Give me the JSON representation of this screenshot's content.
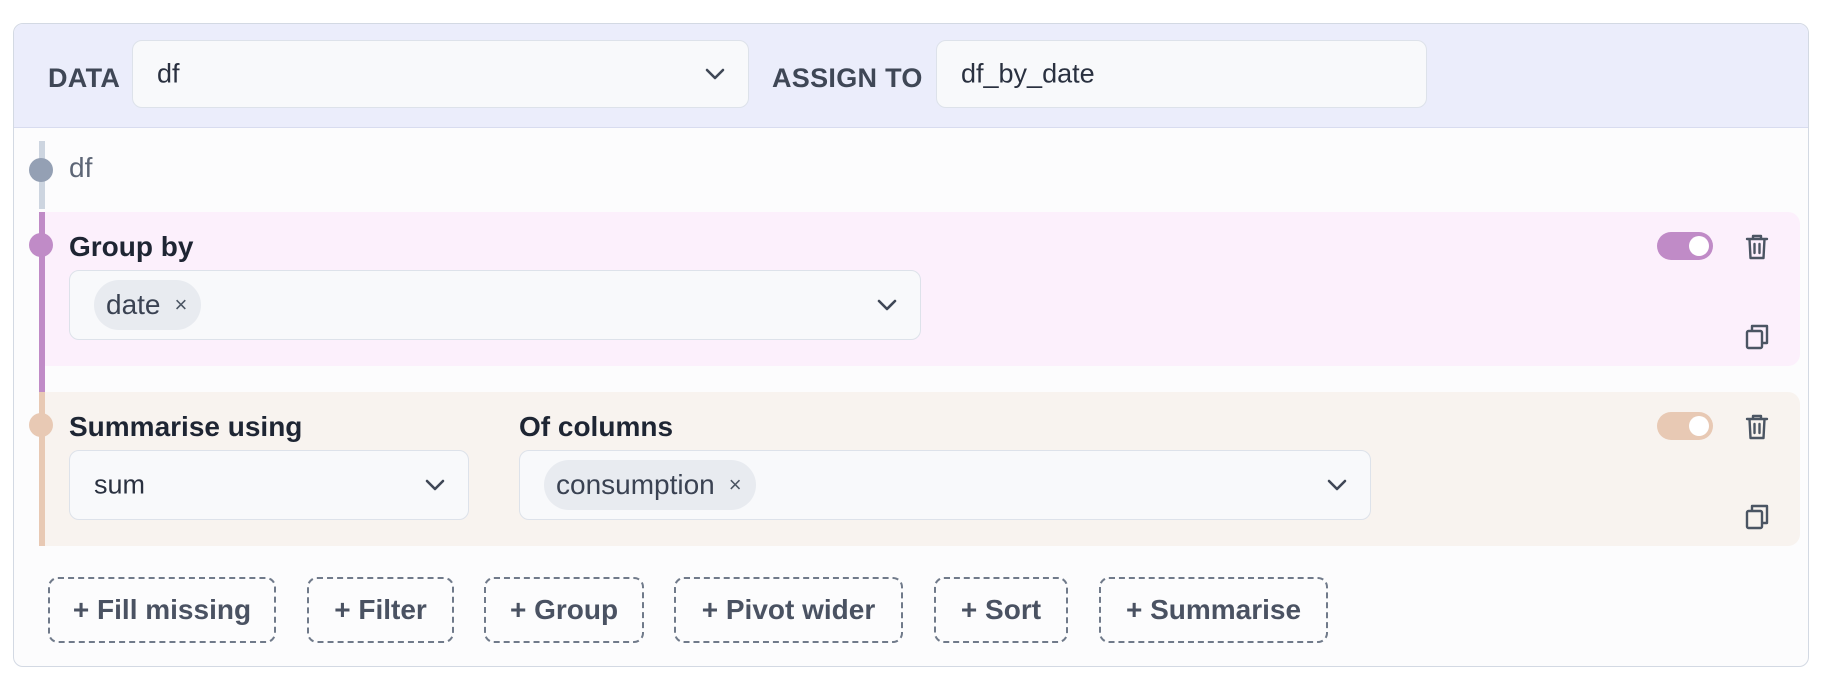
{
  "header": {
    "data_label": "DATA",
    "data_value": "df",
    "assign_label": "ASSIGN TO",
    "assign_value": "df_by_date"
  },
  "source": {
    "label": "df"
  },
  "steps": [
    {
      "title": "Group by",
      "chips": [
        "date"
      ],
      "enabled": true,
      "color": "#c08bc7"
    },
    {
      "title": "Summarise using",
      "function_value": "sum",
      "columns_title": "Of columns",
      "chips": [
        "consumption"
      ],
      "enabled": true,
      "color": "#e8c9b4"
    }
  ],
  "add_buttons": [
    "+ Fill missing",
    "+ Filter",
    "+ Group",
    "+ Pivot wider",
    "+ Sort",
    "+ Summarise"
  ],
  "chip_remove_glyph": "×",
  "colors": {
    "header_bg": "#ebedfb",
    "source_dot": "#94a0b4",
    "group_bg": "#fcf0fc",
    "summarise_bg": "#f8f3ef"
  }
}
